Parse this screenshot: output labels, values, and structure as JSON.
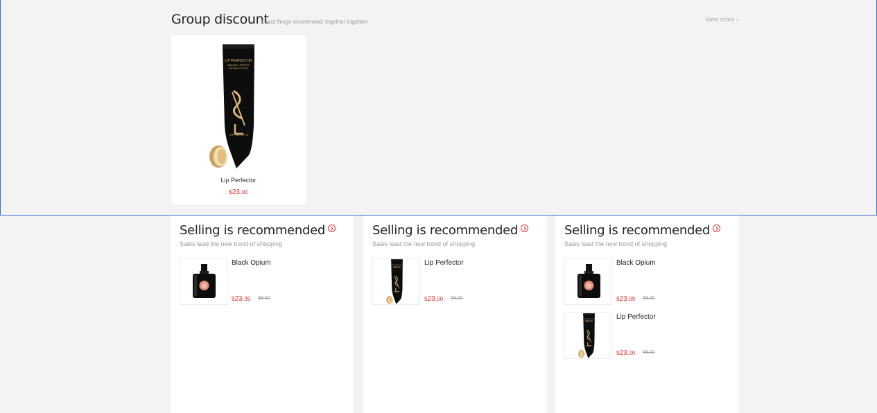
{
  "group": {
    "title": "Group discount",
    "subtitle": "Good things recommend, together together",
    "view_more": "View more ›",
    "product": {
      "name": "Lip Perfector",
      "currency": "$",
      "price_main": "23.",
      "price_cents": "00",
      "image": "lip-perfector-tube-icon"
    }
  },
  "panels": [
    {
      "title": "Selling is recommended",
      "subtitle": "Sales lead the new trend of shopping",
      "items": [
        {
          "name": "Black Opium",
          "currency": "$",
          "price_main": "23.",
          "price_cents": "99",
          "old_price": "89.00",
          "image": "black-opium-bottle-icon"
        }
      ]
    },
    {
      "title": "Selling is recommended",
      "subtitle": "Sales lead the new trend of shopping",
      "items": [
        {
          "name": "Lip Perfector",
          "currency": "$",
          "price_main": "23.",
          "price_cents": "00",
          "old_price": "69.00",
          "image": "lip-perfector-tube-icon"
        }
      ]
    },
    {
      "title": "Selling is recommended",
      "subtitle": "Sales lead the new trend of shopping",
      "items": [
        {
          "name": "Black Opium",
          "currency": "$",
          "price_main": "23.",
          "price_cents": "99",
          "old_price": "89.00",
          "image": "black-opium-bottle-icon"
        },
        {
          "name": "Lip Perfector",
          "currency": "$",
          "price_main": "23.",
          "price_cents": "00",
          "old_price": "69.00",
          "image": "lip-perfector-tube-icon"
        }
      ]
    }
  ],
  "colors": {
    "accent_red": "#e0322e",
    "page_bg": "#f3f3f3",
    "card_bg": "#ffffff"
  }
}
